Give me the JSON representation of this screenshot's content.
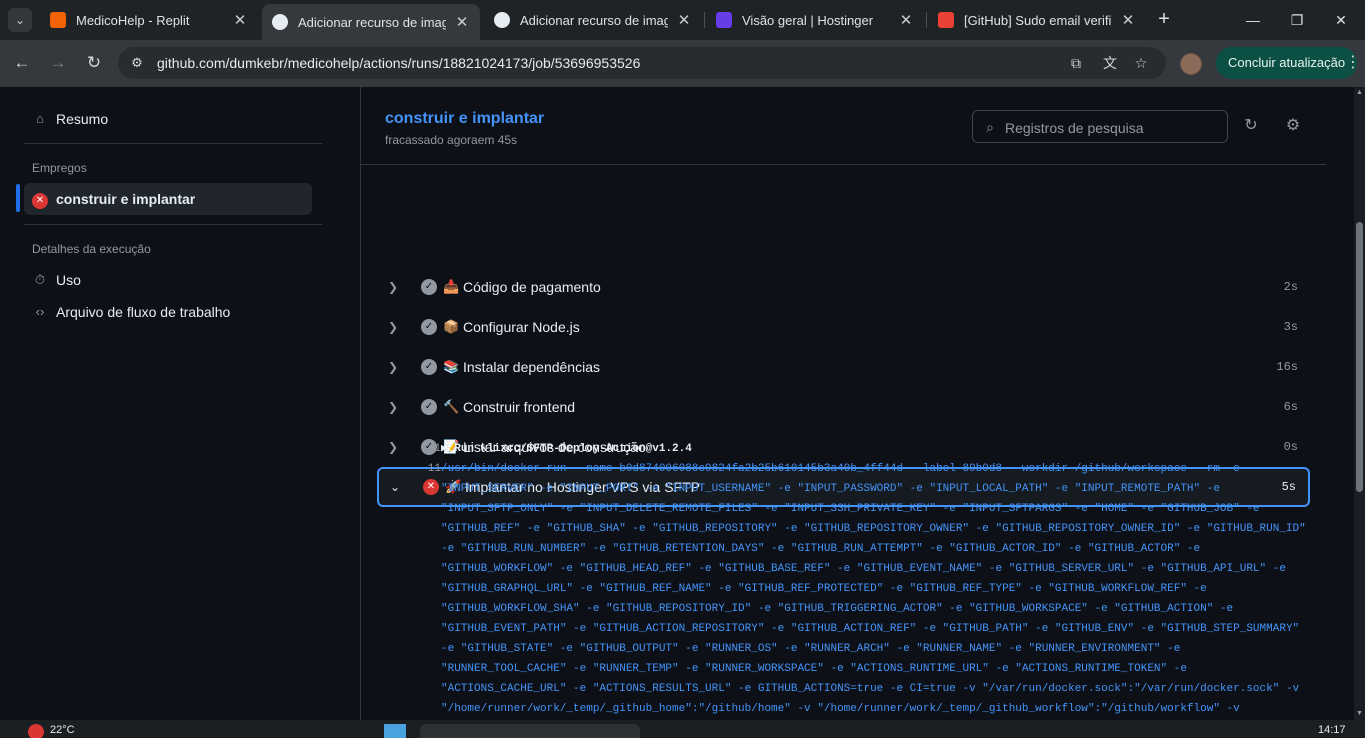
{
  "browser": {
    "tabs": [
      {
        "title": "MedicoHelp - Replit",
        "favicon_color": "#f26207"
      },
      {
        "title": "Adicionar recurso de imagem",
        "favicon_color": "#e6edf3",
        "active": true
      },
      {
        "title": "Adicionar recurso de imagem",
        "favicon_color": "#e6edf3"
      },
      {
        "title": "Visão geral | Hostinger",
        "favicon_color": "#673de6"
      },
      {
        "title": "[GitHub] Sudo email verificat",
        "favicon_color": "#ea4335"
      }
    ],
    "url": "github.com/dumkebr/medicohelp/actions/runs/18821024173/job/53696953526",
    "update_label": "Concluir atualização"
  },
  "sidebar": {
    "summary_label": "Resumo",
    "jobs_heading": "Empregos",
    "job_label": "construir e implantar",
    "details_heading": "Detalhes da execução",
    "usage_label": "Uso",
    "workflow_file_label": "Arquivo de fluxo de trabalho"
  },
  "job": {
    "title": "construir e implantar",
    "subtitle": "fracassado agoraem 45s",
    "search_placeholder": "Registros de pesquisa"
  },
  "steps": [
    {
      "emoji": "📥",
      "name": "Código de pagamento",
      "duration": "2s",
      "status": "success"
    },
    {
      "emoji": "📦",
      "name": "Configurar Node.js",
      "duration": "3s",
      "status": "success"
    },
    {
      "emoji": "📚",
      "name": "Instalar dependências",
      "duration": "16s",
      "status": "success"
    },
    {
      "emoji": "🔨",
      "name": "Construir frontend",
      "duration": "6s",
      "status": "success"
    },
    {
      "emoji": "📝",
      "name": "Listar arquivos de construção",
      "duration": "0s",
      "status": "success"
    },
    {
      "emoji": "🚀",
      "name": "Implantar no Hostinger VPS via SFTP",
      "duration": "5s",
      "status": "failure",
      "expanded": true
    }
  ],
  "log": [
    {
      "num": "1",
      "text": "▶ Run wlixcc/SFTP-Deploy-Action@v1.2.4",
      "style": "bold"
    },
    {
      "num": "11",
      "text": "/usr/bin/docker run --name b0d874006088c9824fa2b25b610145b3a40b_4ff44d --label 89b0d8 --workdir /github/workspace --rm -e",
      "style": "blue"
    },
    {
      "num": "",
      "text": "\"INPUT_SERVER\" -e \"INPUT_PORT\" -e \"INPUT_USERNAME\" -e \"INPUT_PASSWORD\" -e \"INPUT_LOCAL_PATH\" -e \"INPUT_REMOTE_PATH\" -e",
      "style": "blue"
    },
    {
      "num": "",
      "text": "\"INPUT_SFTP_ONLY\" -e \"INPUT_DELETE_REMOTE_FILES\" -e \"INPUT_SSH_PRIVATE_KEY\" -e \"INPUT_SFTPARGS\" -e \"HOME\" -e \"GITHUB_JOB\" -e",
      "style": "blue"
    },
    {
      "num": "",
      "text": "\"GITHUB_REF\" -e \"GITHUB_SHA\" -e \"GITHUB_REPOSITORY\" -e \"GITHUB_REPOSITORY_OWNER\" -e \"GITHUB_REPOSITORY_OWNER_ID\" -e \"GITHUB_RUN_ID\"",
      "style": "blue"
    },
    {
      "num": "",
      "text": "-e \"GITHUB_RUN_NUMBER\" -e \"GITHUB_RETENTION_DAYS\" -e \"GITHUB_RUN_ATTEMPT\" -e \"GITHUB_ACTOR_ID\" -e \"GITHUB_ACTOR\" -e",
      "style": "blue"
    },
    {
      "num": "",
      "text": "\"GITHUB_WORKFLOW\" -e \"GITHUB_HEAD_REF\" -e \"GITHUB_BASE_REF\" -e \"GITHUB_EVENT_NAME\" -e \"GITHUB_SERVER_URL\" -e \"GITHUB_API_URL\" -e",
      "style": "blue"
    },
    {
      "num": "",
      "text": "\"GITHUB_GRAPHQL_URL\" -e \"GITHUB_REF_NAME\" -e \"GITHUB_REF_PROTECTED\" -e \"GITHUB_REF_TYPE\" -e \"GITHUB_WORKFLOW_REF\" -e",
      "style": "blue"
    },
    {
      "num": "",
      "text": "\"GITHUB_WORKFLOW_SHA\" -e \"GITHUB_REPOSITORY_ID\" -e \"GITHUB_TRIGGERING_ACTOR\" -e \"GITHUB_WORKSPACE\" -e \"GITHUB_ACTION\" -e",
      "style": "blue"
    },
    {
      "num": "",
      "text": "\"GITHUB_EVENT_PATH\" -e \"GITHUB_ACTION_REPOSITORY\" -e \"GITHUB_ACTION_REF\" -e \"GITHUB_PATH\" -e \"GITHUB_ENV\" -e \"GITHUB_STEP_SUMMARY\"",
      "style": "blue"
    },
    {
      "num": "",
      "text": "-e \"GITHUB_STATE\" -e \"GITHUB_OUTPUT\" -e \"RUNNER_OS\" -e \"RUNNER_ARCH\" -e \"RUNNER_NAME\" -e \"RUNNER_ENVIRONMENT\" -e",
      "style": "blue"
    },
    {
      "num": "",
      "text": "\"RUNNER_TOOL_CACHE\" -e \"RUNNER_TEMP\" -e \"RUNNER_WORKSPACE\" -e \"ACTIONS_RUNTIME_URL\" -e \"ACTIONS_RUNTIME_TOKEN\" -e",
      "style": "blue"
    },
    {
      "num": "",
      "text": "\"ACTIONS_CACHE_URL\" -e \"ACTIONS_RESULTS_URL\" -e GITHUB_ACTIONS=true -e CI=true -v \"/var/run/docker.sock\":\"/var/run/docker.sock\" -v",
      "style": "blue"
    },
    {
      "num": "",
      "text": "\"/home/runner/work/_temp/_github_home\":\"/github/home\" -v \"/home/runner/work/_temp/_github_workflow\":\"/github/workflow\" -v",
      "style": "blue"
    }
  ],
  "taskbar": {
    "temperature": "22°C",
    "time": "14:17"
  }
}
